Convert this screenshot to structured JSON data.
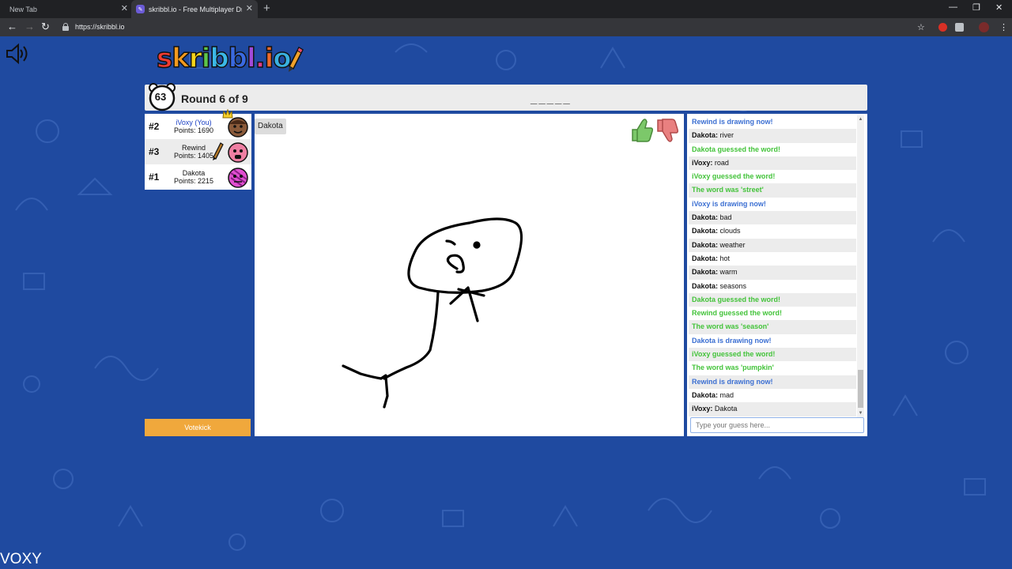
{
  "browser": {
    "tabs": [
      {
        "label": "New Tab"
      },
      {
        "label": "skribbl.io - Free Multiplayer Drawing"
      }
    ],
    "url": "https://skribbl.io"
  },
  "game": {
    "logo": "skribbl.io",
    "timer": "63",
    "round_text": "Round 6 of 9",
    "word_hint": "_____",
    "current_drawer_tag": "Dakota",
    "votekick_label": "Votekick",
    "guess_placeholder": "Type your guess here..."
  },
  "players": [
    {
      "rank": "#2",
      "name": "iVoxy (You)",
      "points": "Points: 1690",
      "avatar_color": "#8a5a3a"
    },
    {
      "rank": "#3",
      "name": "Rewind",
      "points": "Points: 1405",
      "avatar_color": "#ee7fa3"
    },
    {
      "rank": "#1",
      "name": "Dakota",
      "points": "Points: 2215",
      "avatar_color": "#e04fd0"
    }
  ],
  "chat": [
    {
      "type": "blue",
      "text": "Rewind is drawing now!"
    },
    {
      "type": "user",
      "user": "Dakota:",
      "text": "river"
    },
    {
      "type": "green",
      "text": "Dakota guessed the word!"
    },
    {
      "type": "user",
      "user": "iVoxy:",
      "text": "road"
    },
    {
      "type": "green",
      "text": "iVoxy guessed the word!"
    },
    {
      "type": "green",
      "text": "The word was 'street'"
    },
    {
      "type": "blue",
      "text": "iVoxy is drawing now!"
    },
    {
      "type": "user",
      "user": "Dakota:",
      "text": "bad"
    },
    {
      "type": "user",
      "user": "Dakota:",
      "text": "clouds"
    },
    {
      "type": "user",
      "user": "Dakota:",
      "text": "weather"
    },
    {
      "type": "user",
      "user": "Dakota:",
      "text": "hot"
    },
    {
      "type": "user",
      "user": "Dakota:",
      "text": "warm"
    },
    {
      "type": "user",
      "user": "Dakota:",
      "text": "seasons"
    },
    {
      "type": "green",
      "text": "Dakota guessed the word!"
    },
    {
      "type": "green",
      "text": "Rewind guessed the word!"
    },
    {
      "type": "green",
      "text": "The word was 'season'"
    },
    {
      "type": "blue",
      "text": "Dakota is drawing now!"
    },
    {
      "type": "green",
      "text": "iVoxy guessed the word!"
    },
    {
      "type": "green",
      "text": "The word was 'pumpkin'"
    },
    {
      "type": "blue",
      "text": "Rewind is drawing now!"
    },
    {
      "type": "user",
      "user": "Dakota:",
      "text": "mad"
    },
    {
      "type": "user",
      "user": "iVoxy:",
      "text": "Dakota"
    }
  ],
  "watermark": "VOXY",
  "colors": {
    "background": "#1f4aa0",
    "guessed": "#43c33a",
    "drawing_notice": "#3b6fd2",
    "votekick": "#f0a83c"
  }
}
